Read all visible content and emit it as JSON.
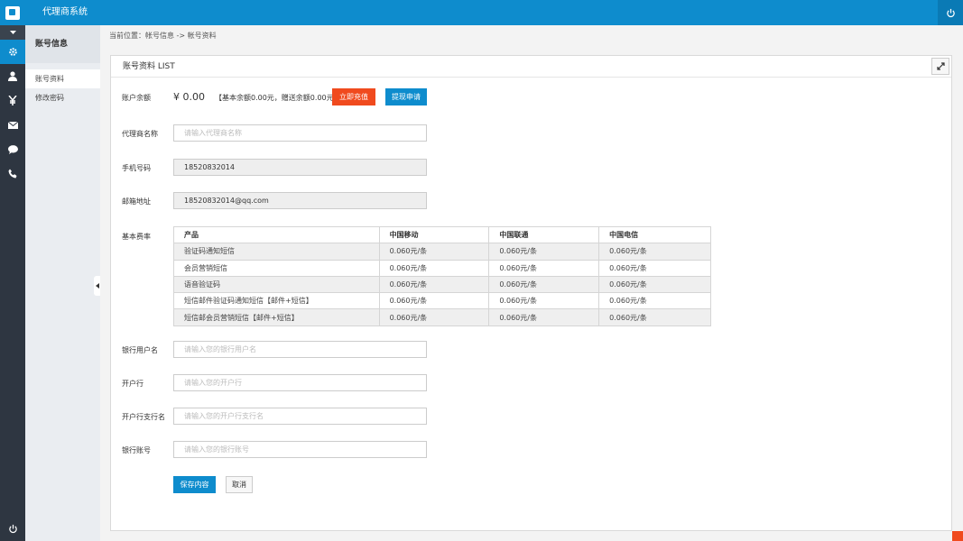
{
  "app": {
    "title": "代理商系统"
  },
  "colors": {
    "primary": "#0e8ccd",
    "danger": "#f04a1e",
    "rail": "#2e3641"
  },
  "rail": {
    "icons": [
      "gear-icon",
      "user-icon",
      "yen-icon",
      "mail-icon",
      "chat-icon",
      "phone-icon"
    ],
    "active_index": 0
  },
  "subnav": {
    "heading": "账号信息",
    "items": [
      {
        "label": "账号资料",
        "active": true
      },
      {
        "label": "修改密码",
        "active": false
      }
    ]
  },
  "breadcrumb": "当前位置：帐号信息 -> 帐号资料",
  "panel": {
    "title": "账号资料 LIST",
    "balance": {
      "label": "账户余额",
      "amount": "¥ 0.00",
      "note": "【基本余额0.00元，赠送余额0.00元】",
      "recharge_label": "立即充值",
      "withdraw_label": "提现申请"
    },
    "agent_name": {
      "label": "代理商名称",
      "placeholder": "请输入代理商名称",
      "value": ""
    },
    "phone": {
      "label": "手机号码",
      "value": "18520832014"
    },
    "email": {
      "label": "邮箱地址",
      "value": "18520832014@qq.com"
    },
    "rates": {
      "label": "基本费率",
      "headers": [
        "产品",
        "中国移动",
        "中国联通",
        "中国电信"
      ],
      "rows": [
        [
          "验证码通知短信",
          "0.060元/条",
          "0.060元/条",
          "0.060元/条"
        ],
        [
          "会员营销短信",
          "0.060元/条",
          "0.060元/条",
          "0.060元/条"
        ],
        [
          "语音验证码",
          "0.060元/条",
          "0.060元/条",
          "0.060元/条"
        ],
        [
          "短信邮件验证码通知短信【邮件+短信】",
          "0.060元/条",
          "0.060元/条",
          "0.060元/条"
        ],
        [
          "短信邮会员营销短信【邮件+短信】",
          "0.060元/条",
          "0.060元/条",
          "0.060元/条"
        ]
      ]
    },
    "bank_user": {
      "label": "银行用户名",
      "placeholder": "请输入您的银行用户名",
      "value": ""
    },
    "bank": {
      "label": "开户行",
      "placeholder": "请输入您的开户行",
      "value": ""
    },
    "branch": {
      "label": "开户行支行名",
      "placeholder": "请输入您的开户行支行名",
      "value": ""
    },
    "account": {
      "label": "银行账号",
      "placeholder": "请输入您的银行账号",
      "value": ""
    },
    "save_label": "保存内容",
    "cancel_label": "取消"
  }
}
